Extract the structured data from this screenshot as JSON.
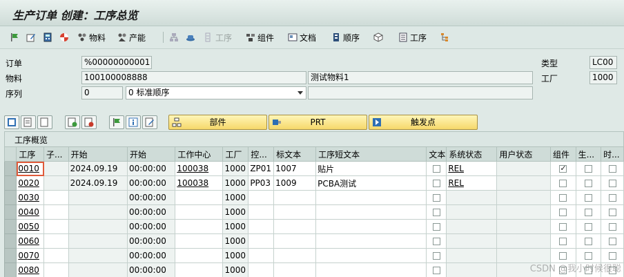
{
  "window": {
    "title": "生产订单 创建：工序总览"
  },
  "toolbar": {
    "items": [
      {
        "label": "",
        "icon": "flag-icon"
      },
      {
        "label": "",
        "icon": "edit-icon"
      },
      {
        "label": "",
        "icon": "calculator-icon"
      },
      {
        "label": "",
        "icon": "status-ball-icon"
      },
      {
        "label": "物料",
        "icon": "material-icon"
      },
      {
        "label": "产能",
        "icon": "capacity-icon"
      },
      {
        "label": "",
        "icon": "network-icon"
      },
      {
        "label": "",
        "icon": "hat-icon"
      },
      {
        "label": "工序",
        "icon": "operation-icon",
        "disabled": true
      },
      {
        "label": "组件",
        "icon": "components-icon"
      },
      {
        "label": "文档",
        "icon": "document-icon"
      },
      {
        "label": "顺序",
        "icon": "sequence-icon"
      },
      {
        "label": "",
        "icon": "cube-icon"
      },
      {
        "label": "工序",
        "icon": "operations-list-icon"
      },
      {
        "label": "",
        "icon": "hierarchy-icon"
      }
    ]
  },
  "header": {
    "order_label": "订单",
    "order_value": "%00000000001",
    "material_label": "物料",
    "material_value": "100100008888",
    "material_desc": "测试物料1",
    "sequence_label": "序列",
    "sequence_value": "0",
    "sequence_select": "0 标准顺序",
    "type_label": "类型",
    "type_value": "LC00",
    "plant_label": "工厂",
    "plant_value": "1000"
  },
  "buttons": {
    "parts": "部件",
    "prt": "PRT",
    "trigger": "触发点"
  },
  "overview": {
    "title": "工序概览",
    "columns": [
      "工序",
      "子...",
      "开始",
      "开始",
      "工作中心",
      "工厂",
      "控...",
      "标文本",
      "工序短文本",
      "文本",
      "系统状态",
      "用户状态",
      "组件",
      "生...",
      "时..."
    ],
    "rows": [
      {
        "op": "0010",
        "sub": "",
        "date": "2024.09.19",
        "time": "00:00:00",
        "wc": "100038",
        "plant": "1000",
        "ctrl": "ZP01",
        "std": "1007",
        "short": "贴片",
        "sys": "REL",
        "user": "",
        "comp": true
      },
      {
        "op": "0020",
        "sub": "",
        "date": "2024.09.19",
        "time": "00:00:00",
        "wc": "100038",
        "plant": "1000",
        "ctrl": "PP03",
        "std": "1009",
        "short": "PCBA测试",
        "sys": "REL",
        "user": "",
        "comp": false
      },
      {
        "op": "0030",
        "sub": "",
        "date": "",
        "time": "00:00:00",
        "wc": "",
        "plant": "1000",
        "ctrl": "",
        "std": "",
        "short": "",
        "sys": "",
        "user": "",
        "comp": false
      },
      {
        "op": "0040",
        "sub": "",
        "date": "",
        "time": "00:00:00",
        "wc": "",
        "plant": "1000",
        "ctrl": "",
        "std": "",
        "short": "",
        "sys": "",
        "user": "",
        "comp": false
      },
      {
        "op": "0050",
        "sub": "",
        "date": "",
        "time": "00:00:00",
        "wc": "",
        "plant": "1000",
        "ctrl": "",
        "std": "",
        "short": "",
        "sys": "",
        "user": "",
        "comp": false
      },
      {
        "op": "0060",
        "sub": "",
        "date": "",
        "time": "00:00:00",
        "wc": "",
        "plant": "1000",
        "ctrl": "",
        "std": "",
        "short": "",
        "sys": "",
        "user": "",
        "comp": false
      },
      {
        "op": "0070",
        "sub": "",
        "date": "",
        "time": "00:00:00",
        "wc": "",
        "plant": "1000",
        "ctrl": "",
        "std": "",
        "short": "",
        "sys": "",
        "user": "",
        "comp": false
      },
      {
        "op": "0080",
        "sub": "",
        "date": "",
        "time": "00:00:00",
        "wc": "",
        "plant": "1000",
        "ctrl": "",
        "std": "",
        "short": "",
        "sys": "",
        "user": "",
        "comp": false
      }
    ]
  },
  "watermark": "CSDN @我小时候很聪",
  "colors": {
    "title_bg": "#dde8e5",
    "button_yellow": "#f6d86a",
    "focus": "#e05a3a"
  }
}
